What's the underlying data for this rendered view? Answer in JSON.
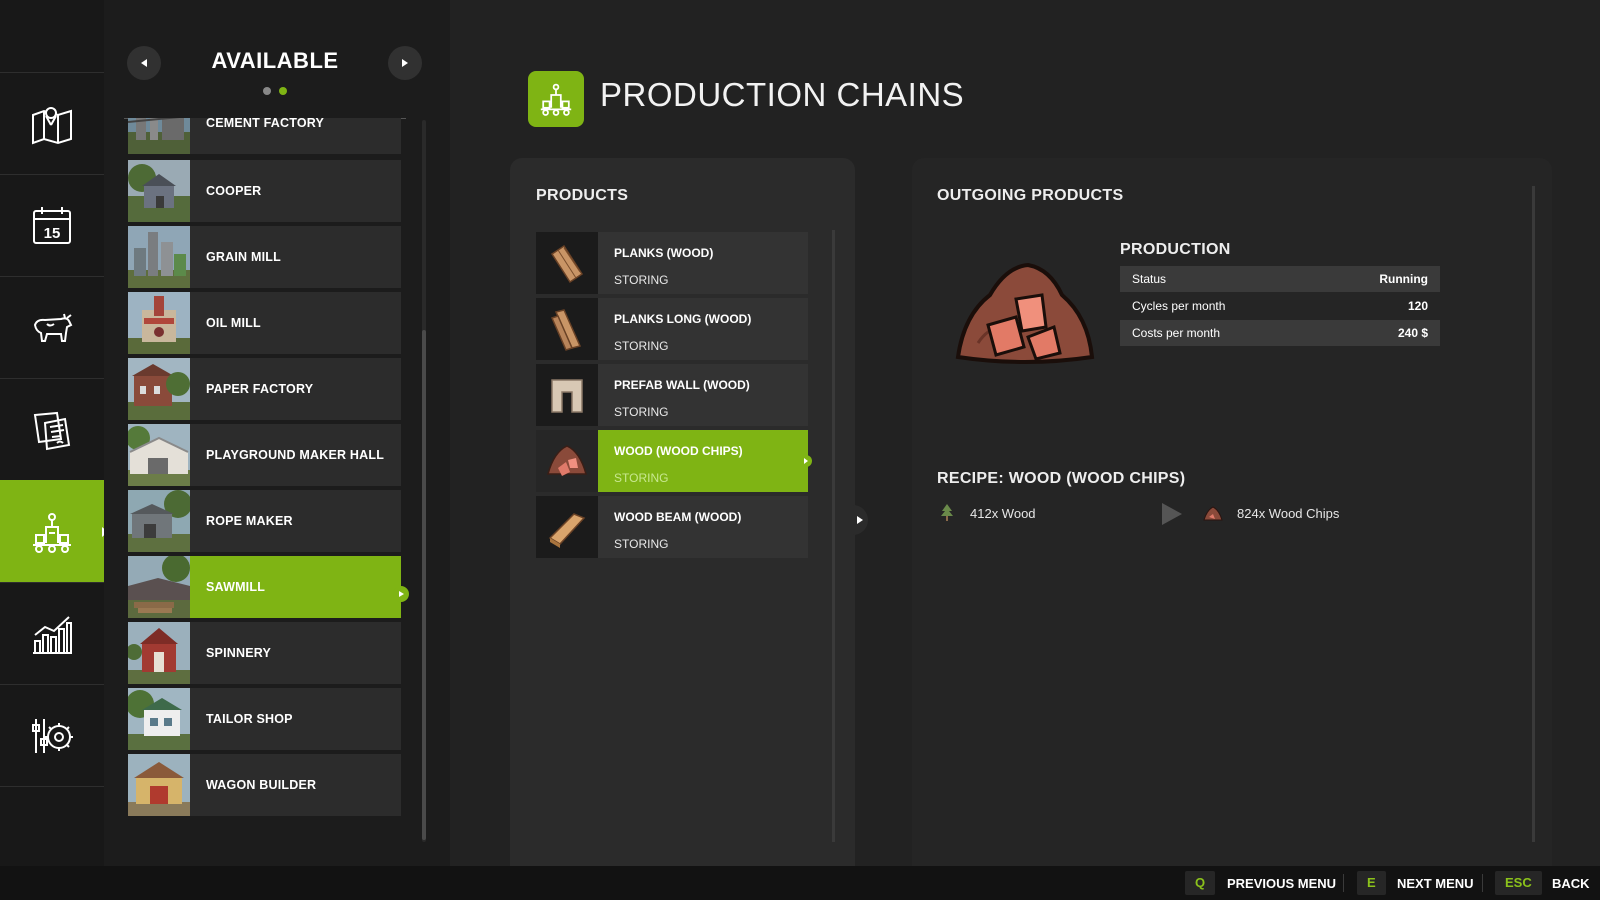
{
  "header": {
    "title": "PRODUCTION CHAINS",
    "icon": "factory-icon",
    "accent_color": "#7fb414"
  },
  "nav": {
    "items": [
      {
        "icon": "map-icon"
      },
      {
        "icon": "calendar-icon",
        "calendar_day": "15"
      },
      {
        "icon": "livestock-icon"
      },
      {
        "icon": "contracts-icon"
      },
      {
        "icon": "production-icon",
        "active": true
      },
      {
        "icon": "statistics-icon"
      },
      {
        "icon": "settings-icon"
      }
    ]
  },
  "available": {
    "title": "AVAILABLE",
    "page_count": 2,
    "current_page": 2,
    "items": [
      {
        "label": "CEMENT FACTORY"
      },
      {
        "label": "COOPER"
      },
      {
        "label": "GRAIN MILL"
      },
      {
        "label": "OIL MILL"
      },
      {
        "label": "PAPER FACTORY"
      },
      {
        "label": "PLAYGROUND MAKER HALL"
      },
      {
        "label": "ROPE MAKER"
      },
      {
        "label": "SAWMILL",
        "selected": true
      },
      {
        "label": "SPINNERY"
      },
      {
        "label": "TAILOR SHOP"
      },
      {
        "label": "WAGON BUILDER"
      }
    ]
  },
  "products": {
    "heading": "PRODUCTS",
    "items": [
      {
        "name": "PLANKS (WOOD)",
        "status": "STORING",
        "icon": "planks-icon"
      },
      {
        "name": "PLANKS LONG (WOOD)",
        "status": "STORING",
        "icon": "planks-long-icon"
      },
      {
        "name": "PREFAB WALL (WOOD)",
        "status": "STORING",
        "icon": "prefab-wall-icon"
      },
      {
        "name": "WOOD (WOOD CHIPS)",
        "status": "STORING",
        "icon": "woodchips-icon",
        "selected": true
      },
      {
        "name": "WOOD BEAM (WOOD)",
        "status": "STORING",
        "icon": "wood-beam-icon"
      }
    ]
  },
  "outgoing": {
    "heading": "OUTGOING PRODUCTS",
    "product_icon": "woodchips-pile-icon",
    "production": {
      "heading": "PRODUCTION",
      "rows": [
        {
          "label": "Status",
          "value": "Running"
        },
        {
          "label": "Cycles per month",
          "value": "120"
        },
        {
          "label": "Costs per month",
          "value": "240 $"
        }
      ]
    },
    "recipe": {
      "title": "RECIPE: WOOD (WOOD CHIPS)",
      "input": {
        "text": "412x Wood",
        "icon": "tree-icon"
      },
      "output": {
        "text": "824x Wood Chips",
        "icon": "woodchips-icon"
      }
    }
  },
  "footer": {
    "items": [
      {
        "key": "Q",
        "label": "PREVIOUS MENU"
      },
      {
        "key": "E",
        "label": "NEXT MENU"
      },
      {
        "key": "ESC",
        "label": "BACK"
      }
    ]
  }
}
